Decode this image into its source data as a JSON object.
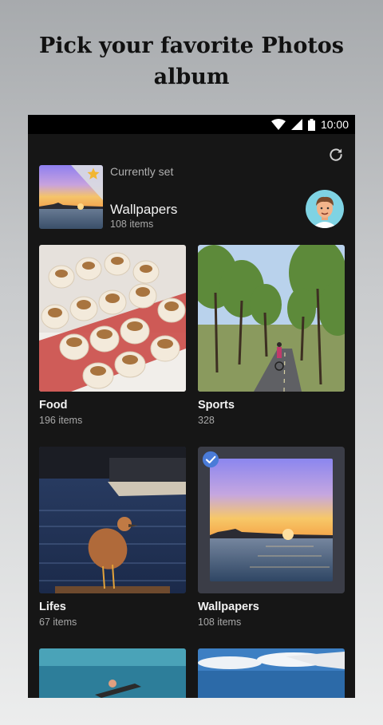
{
  "promo": {
    "title": "Pick your favorite Photos album"
  },
  "status_bar": {
    "time": "10:00"
  },
  "header": {
    "currently_set_label": "Currently set",
    "album_name": "Wallpapers",
    "album_count": "108 items"
  },
  "albums": [
    {
      "name": "Food",
      "count": "196 items"
    },
    {
      "name": "Sports",
      "count": "328"
    },
    {
      "name": "Lifes",
      "count": "67 items"
    },
    {
      "name": "Wallpapers",
      "count": "108 items",
      "selected": true
    }
  ],
  "icons": [
    "wifi-icon",
    "signal-icon",
    "battery-icon",
    "refresh-icon",
    "star-icon",
    "check-icon",
    "avatar"
  ],
  "colors": {
    "background": "#161616",
    "selection_frame": "#3b3d47",
    "check_badge": "#4a7bd8",
    "star": "#f2b632"
  }
}
